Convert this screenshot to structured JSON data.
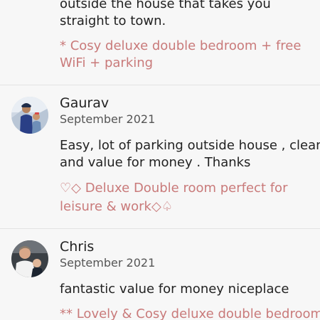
{
  "previous_review": {
    "text_lines": [
      "outside the house that takes you",
      "straight to town."
    ],
    "listing_lines": [
      "* Cosy deluxe double bedroom + free",
      "WiFi + parking"
    ]
  },
  "reviews": [
    {
      "name": "Gaurav",
      "date": "September 2021",
      "text_lines": [
        "Easy, lot of parking outside house , clean",
        "and value for money . Thanks"
      ],
      "listing_lines": [
        "♡◇ Deluxe Double room perfect for",
        "leisure & work◇♤"
      ]
    },
    {
      "name": "Chris",
      "date": "September 2021",
      "text_lines": [
        "fantastic value for money niceplace"
      ],
      "listing_lines": [
        "** Lovely & Cosy deluxe double bedroom"
      ]
    }
  ],
  "colors": {
    "background": "#f7f7f7",
    "text": "#222222",
    "secondary_text": "#555555",
    "listing_link": "#c97a7a",
    "divider": "#e3e3e3"
  }
}
